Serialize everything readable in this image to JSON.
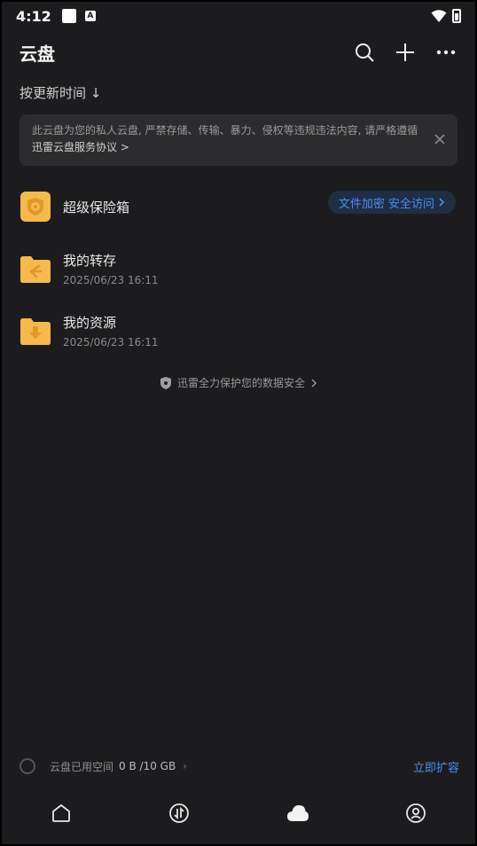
{
  "status_bar": {
    "time": "4:12",
    "indicator": "A"
  },
  "header": {
    "title": "云盘"
  },
  "sort": {
    "label": "按更新时间 ↓"
  },
  "notice": {
    "text": "此云盘为您的私人云盘, 严禁存储、传输、暴力、侵权等违规违法内容, 请严格遵循",
    "link": "迅雷云盘服务协议 >"
  },
  "files": [
    {
      "name": "超级保险箱",
      "badge": "文件加密 安全访问"
    },
    {
      "name": "我的转存",
      "date": "2025/06/23 16:11"
    },
    {
      "name": "我的资源",
      "date": "2025/06/23 16:11"
    }
  ],
  "protect": {
    "text": "迅雷全力保护您的数据安全"
  },
  "storage": {
    "label": "云盘已用空间",
    "used": "0 B /10 GB",
    "expand": "立即扩容"
  },
  "colors": {
    "accent": "#4d8ef0",
    "folder": "#f5b94c",
    "background": "#1c1c1e"
  },
  "tabs": [
    {
      "icon": "home-icon"
    },
    {
      "icon": "transfer-icon"
    },
    {
      "icon": "cloud-icon"
    },
    {
      "icon": "profile-icon"
    }
  ]
}
